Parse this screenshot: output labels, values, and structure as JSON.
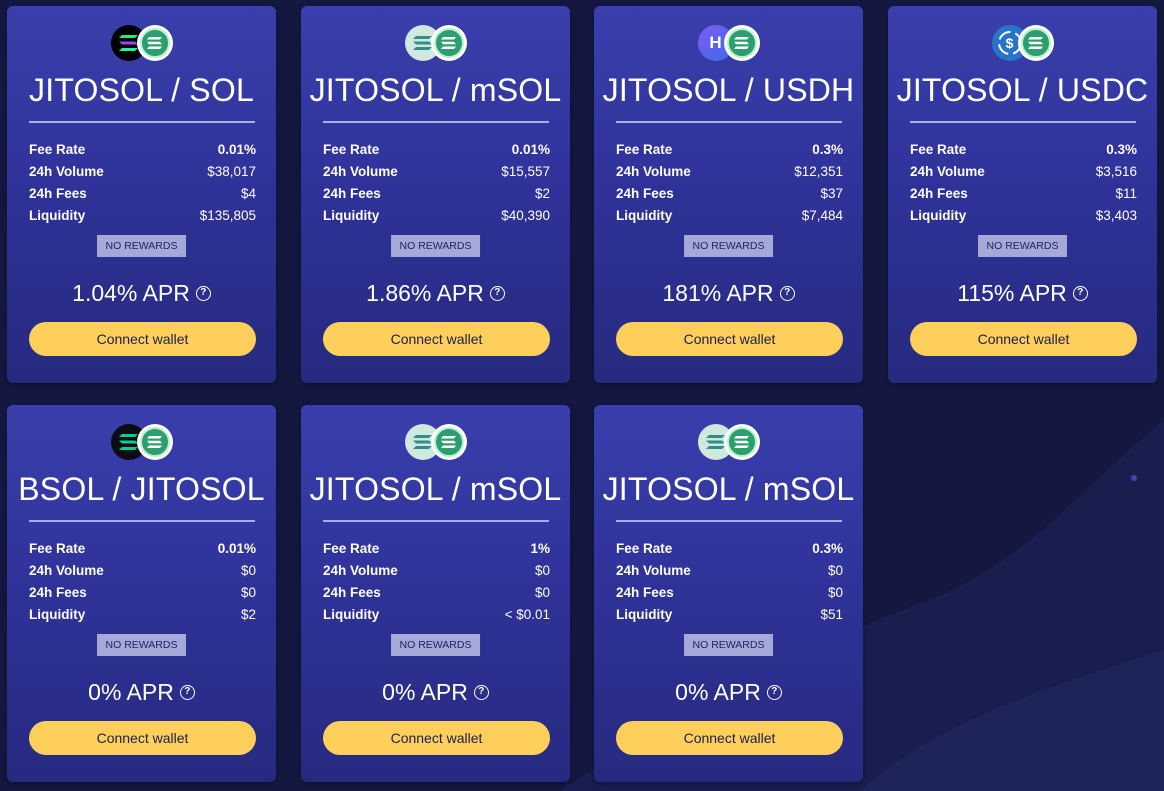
{
  "pools": [
    {
      "title": "JITOSOL / SOL",
      "icons": [
        "solana-icon",
        "jitosol-icon"
      ],
      "fee_rate_label": "Fee Rate",
      "fee_rate": "0.01%",
      "volume_label": "24h Volume",
      "volume": "$38,017",
      "fees_label": "24h Fees",
      "fees": "$4",
      "liquidity_label": "Liquidity",
      "liquidity": "$135,805",
      "rewards": "NO REWARDS",
      "apr": "1.04% APR",
      "help": "?",
      "button": "Connect wallet"
    },
    {
      "title": "JITOSOL / mSOL",
      "icons": [
        "msol-icon",
        "jitosol-icon"
      ],
      "fee_rate_label": "Fee Rate",
      "fee_rate": "0.01%",
      "volume_label": "24h Volume",
      "volume": "$15,557",
      "fees_label": "24h Fees",
      "fees": "$2",
      "liquidity_label": "Liquidity",
      "liquidity": "$40,390",
      "rewards": "NO REWARDS",
      "apr": "1.86% APR",
      "help": "?",
      "button": "Connect wallet"
    },
    {
      "title": "JITOSOL / USDH",
      "icons": [
        "usdh-icon",
        "jitosol-icon"
      ],
      "fee_rate_label": "Fee Rate",
      "fee_rate": "0.3%",
      "volume_label": "24h Volume",
      "volume": "$12,351",
      "fees_label": "24h Fees",
      "fees": "$37",
      "liquidity_label": "Liquidity",
      "liquidity": "$7,484",
      "rewards": "NO REWARDS",
      "apr": "181% APR",
      "help": "?",
      "button": "Connect wallet"
    },
    {
      "title": "JITOSOL / USDC",
      "icons": [
        "usdc-icon",
        "jitosol-icon"
      ],
      "fee_rate_label": "Fee Rate",
      "fee_rate": "0.3%",
      "volume_label": "24h Volume",
      "volume": "$3,516",
      "fees_label": "24h Fees",
      "fees": "$11",
      "liquidity_label": "Liquidity",
      "liquidity": "$3,403",
      "rewards": "NO REWARDS",
      "apr": "115% APR",
      "help": "?",
      "button": "Connect wallet"
    },
    {
      "title": "BSOL / JITOSOL",
      "icons": [
        "bsol-icon",
        "jitosol-icon"
      ],
      "fee_rate_label": "Fee Rate",
      "fee_rate": "0.01%",
      "volume_label": "24h Volume",
      "volume": "$0",
      "fees_label": "24h Fees",
      "fees": "$0",
      "liquidity_label": "Liquidity",
      "liquidity": "$2",
      "rewards": "NO REWARDS",
      "apr": "0% APR",
      "help": "?",
      "button": "Connect wallet"
    },
    {
      "title": "JITOSOL / mSOL",
      "icons": [
        "msol-icon",
        "jitosol-icon"
      ],
      "fee_rate_label": "Fee Rate",
      "fee_rate": "1%",
      "volume_label": "24h Volume",
      "volume": "$0",
      "fees_label": "24h Fees",
      "fees": "$0",
      "liquidity_label": "Liquidity",
      "liquidity": "< $0.01",
      "rewards": "NO REWARDS",
      "apr": "0% APR",
      "help": "?",
      "button": "Connect wallet"
    },
    {
      "title": "JITOSOL / mSOL",
      "icons": [
        "msol-icon",
        "jitosol-icon"
      ],
      "fee_rate_label": "Fee Rate",
      "fee_rate": "0.3%",
      "volume_label": "24h Volume",
      "volume": "$0",
      "fees_label": "24h Fees",
      "fees": "$0",
      "liquidity_label": "Liquidity",
      "liquidity": "$51",
      "rewards": "NO REWARDS",
      "apr": "0% APR",
      "help": "?",
      "button": "Connect wallet"
    }
  ],
  "usdh_letter": "H",
  "usdc_symbol": "$",
  "colors": {
    "background": "#141840",
    "card_top": "#3a3fad",
    "card_bottom": "#262a7f",
    "button": "#ffcf5c",
    "badge": "#a4a9d8"
  }
}
